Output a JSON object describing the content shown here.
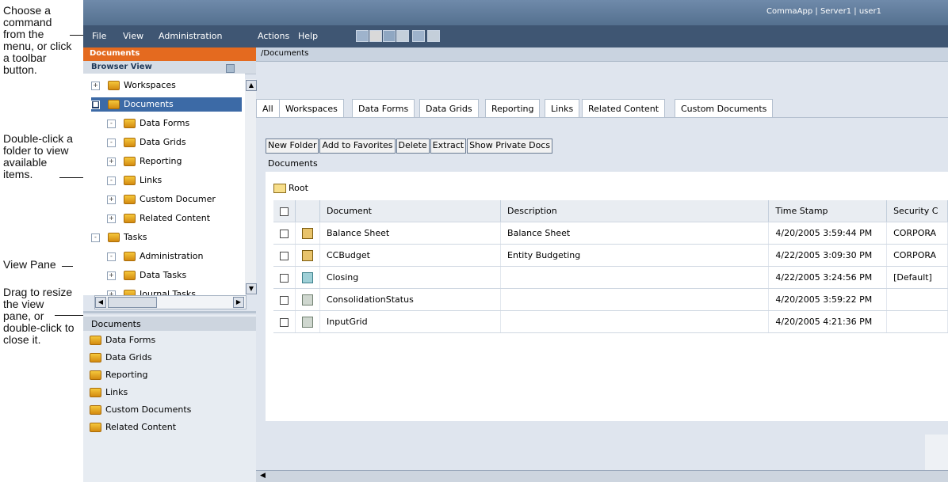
{
  "callouts": [
    "Choose a command from the menu, or click a toolbar button.",
    "Double-click a folder to view available items.",
    "View Pane",
    "Drag to resize the view pane, or double-click to close it."
  ],
  "titlebar": {
    "right_text": "CommaApp | Server1 | user1"
  },
  "menu": {
    "items": [
      "File",
      "View",
      "Administration",
      "Actions",
      "Help"
    ],
    "toolbar_icons": [
      "toolbar-icon-1",
      "toolbar-icon-2",
      "toolbar-icon-3",
      "toolbar-icon-4",
      "toolbar-icon-5",
      "toolbar-icon-6"
    ]
  },
  "left_pane": {
    "title": "Documents",
    "browser_view": "Browser View",
    "tree": [
      {
        "label": "Workspaces",
        "exp": "+"
      },
      {
        "label": "Documents",
        "exp": "■"
      },
      {
        "label": "Data Forms",
        "exp": "-"
      },
      {
        "label": "Data Grids",
        "exp": "-"
      },
      {
        "label": "Reporting",
        "exp": "+"
      },
      {
        "label": "Links",
        "exp": "-"
      },
      {
        "label": "Custom Documer",
        "exp": "+"
      },
      {
        "label": "Related Content",
        "exp": "+"
      },
      {
        "label": "Tasks",
        "exp": "-"
      },
      {
        "label": "Administration",
        "exp": "-"
      },
      {
        "label": "Data Tasks",
        "exp": "+"
      },
      {
        "label": "Journal Tasks",
        "exp": "+"
      }
    ],
    "list_header": "Documents",
    "list": [
      "Data Forms",
      "Data Grids",
      "Reporting",
      "Links",
      "Custom Documents",
      "Related Content"
    ]
  },
  "main": {
    "path": "/Documents",
    "tabs": [
      "All",
      "Workspaces",
      "Data Forms",
      "Data Grids",
      "Reporting",
      "Links",
      "Related Content",
      "Custom Documents"
    ],
    "buttons": [
      "New Folder",
      "Add to Favorites",
      "Delete",
      "Extract",
      "Show Private Docs"
    ],
    "section_label": "Documents",
    "root": "Root",
    "columns": [
      "Document",
      "Description",
      "Time Stamp",
      "Security C"
    ],
    "rows": [
      {
        "icon": "pencil",
        "document": "Balance Sheet",
        "description": "Balance Sheet",
        "time": "4/20/2005 3:59:44 PM",
        "security": "CORPORA"
      },
      {
        "icon": "pencil",
        "document": "CCBudget",
        "description": "Entity Budgeting",
        "time": "4/22/2005 3:09:30 PM",
        "security": "CORPORA"
      },
      {
        "icon": "grid",
        "document": "Closing",
        "description": "",
        "time": "4/22/2005 3:24:56 PM",
        "security": "[Default]"
      },
      {
        "icon": "doc",
        "document": "ConsolidationStatus",
        "description": "",
        "time": "4/20/2005 3:59:22 PM",
        "security": ""
      },
      {
        "icon": "doc",
        "document": "InputGrid",
        "description": "",
        "time": "4/20/2005 4:21:36 PM",
        "security": ""
      }
    ]
  }
}
